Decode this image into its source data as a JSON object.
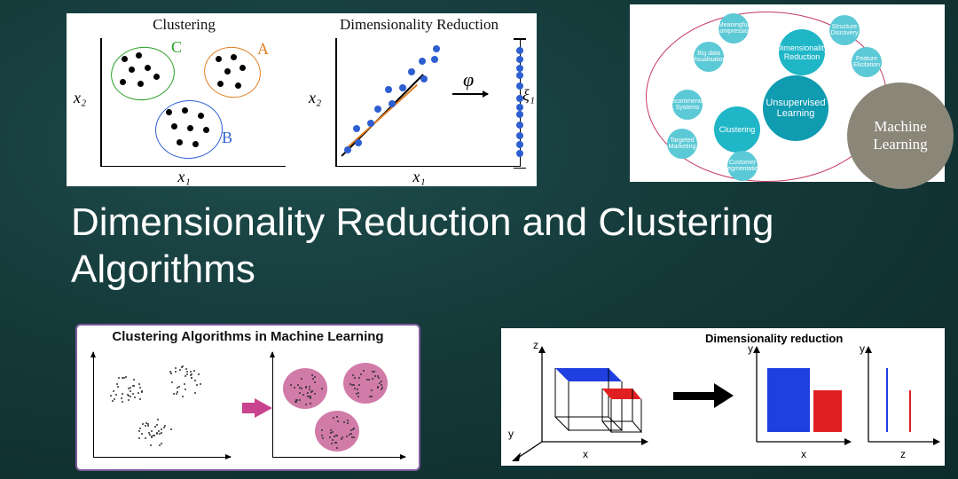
{
  "title": "Dimensionality Reduction and Clustering Algorithms",
  "panelA": {
    "left_header": "Clustering",
    "right_header": "Dimensionality Reduction",
    "xlabel": "x₁",
    "ylabel": "x₂",
    "cluster_labels": {
      "A": "A",
      "B": "B",
      "C": "C"
    },
    "phi": "φ",
    "xi": "ξ₁"
  },
  "panelB": {
    "center": "Unsupervised Learning",
    "machine_learning": "Machine Learning",
    "branches": {
      "dim_red": "Dimensionality Reduction",
      "clustering": "Clustering"
    },
    "leaves": [
      "Meaningful Compression",
      "Structure Discovery",
      "Big data Visualisation",
      "Feature Elicitation",
      "Recommender Systems",
      "Targeted Marketing",
      "Customer Segmentation"
    ]
  },
  "panelC": {
    "title": "Clustering Algorithms in Machine Learning"
  },
  "panelD": {
    "label": "Dimensionality reduction",
    "axes": {
      "x": "x",
      "y": "y",
      "z": "z"
    }
  }
}
